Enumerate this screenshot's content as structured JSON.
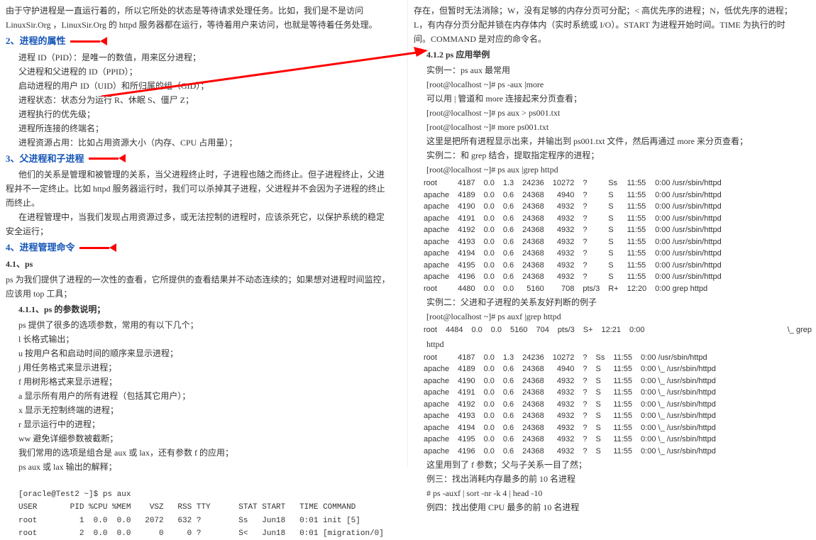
{
  "left": {
    "intro1": "由于守护进程是一直运行着的，所以它所处的状态是等待请求处理任务。比如，我们是不是访问",
    "intro2": "LinuxSir.Org ，LinuxSir.Org 的 httpd 服务器都在运行，等待着用户来访问，也就是等待着任务处理。",
    "h2": "2、进程的属性",
    "attr1": "进程 ID（PID）：是唯一的数值，用来区分进程；",
    "attr2": "父进程和父进程的 ID（PPID）；",
    "attr3": "启动进程的用户 ID（UID）和所归属的组（GID）；",
    "attr4": "进程状态：状态分为运行 R、休眠 S、僵尸 Z；",
    "attr5": "进程执行的优先级；",
    "attr6": "进程所连接的终端名；",
    "attr7": "进程资源占用：比如占用资源大小（内存、CPU 占用量）；",
    "h3": "3、父进程和子进程",
    "rel1": "他们的关系是管理和被管理的关系，当父进程终止时，子进程也随之而终止。但子进程终止，父进",
    "rel2": "程并不一定终止。比如 httpd 服务器运行时，我们可以杀掉其子进程，父进程并不会因为子进程的终止",
    "rel3": "而终止。",
    "rel4": "在进程管理中，当我们发现占用资源过多，或无法控制的进程时，应该杀死它，以保护系统的稳定",
    "rel5": "安全运行；",
    "h4": "4、进程管理命令",
    "h41": "4.1、ps",
    "ps1": "ps 为我们提供了进程的一次性的查看，它所提供的查看结果并不动态连续的；如果想对进程时间监控，",
    "ps2": "应该用 top 工具；",
    "h411": "4.1.1、ps 的参数说明；",
    "param0": "ps 提供了很多的选项参数，常用的有以下几个；",
    "param_l": "l  长格式输出；",
    "param_u": "u  按用户名和启动时间的顺序来显示进程；",
    "param_j": "j  用任务格式来显示进程；",
    "param_f": "f  用树形格式来显示进程；",
    "param_a": "a  显示所有用户的所有进程（包括其它用户）；",
    "param_x": "x  显示无控制终端的进程；",
    "param_r": "r  显示运行中的进程；",
    "param_ww": "ww 避免详细参数被截断；",
    "param_note1": "我们常用的选项是组合是 aux 或 lax，还有参数 f 的应用；",
    "param_note2": "ps aux 或 lax 输出的解释；",
    "code1": "[oracle@Test2 ~]$ ps aux",
    "code2": "USER       PID %CPU %MEM    VSZ   RSS TTY      STAT START   TIME COMMAND",
    "code3": "root         1  0.0  0.0   2072   632 ?        Ss   Jun18   0:01 init [5]",
    "code4": "root         2  0.0  0.0      0     0 ?        S<   Jun18   0:01 [migration/0]"
  },
  "right": {
    "top1": "存在，但暂时无法消除；W，没有足够的内存分页可分配；< 高优先序的进程；N，低优先序的进程；",
    "top2": "L，有内存分页分配并锁在内存体内（实时系统或 I/O）。START 为进程开始时间。TIME 为执行的时",
    "top3": "间。COMMAND 是对应的命令名。",
    "h412": "4.1.2 ps 应用举例",
    "ex1_title": "实例一：ps aux 最常用",
    "ex1_cmd": "[root@localhost ~]# ps -aux |more",
    "ex1_note": "可以用 | 管道和 more 连接起来分页查看；",
    "ex1_cmd2": "[root@localhost ~]# ps   aux   > ps001.txt",
    "ex1_cmd3": "[root@localhost ~]# more ps001.txt",
    "ex1_note2": "这里是把所有进程显示出来，并输出到 ps001.txt 文件，然后再通过 more 来分页查看；",
    "ex2_title": "实例二：和 grep 结合，提取指定程序的进程；",
    "ex2_cmd": "[root@localhost ~]# ps aux |grep httpd",
    "table1": [
      [
        "root",
        "4187",
        "0.0",
        "1.3",
        "24236",
        "10272",
        "?",
        "Ss",
        "11:55",
        "0:00 /usr/sbin/httpd"
      ],
      [
        "apache",
        "4189",
        "0.0",
        "0.6",
        "24368",
        "4940",
        "?",
        "S",
        "11:55",
        "0:00 /usr/sbin/httpd"
      ],
      [
        "apache",
        "4190",
        "0.0",
        "0.6",
        "24368",
        "4932",
        "?",
        "S",
        "11:55",
        "0:00 /usr/sbin/httpd"
      ],
      [
        "apache",
        "4191",
        "0.0",
        "0.6",
        "24368",
        "4932",
        "?",
        "S",
        "11:55",
        "0:00 /usr/sbin/httpd"
      ],
      [
        "apache",
        "4192",
        "0.0",
        "0.6",
        "24368",
        "4932",
        "?",
        "S",
        "11:55",
        "0:00 /usr/sbin/httpd"
      ],
      [
        "apache",
        "4193",
        "0.0",
        "0.6",
        "24368",
        "4932",
        "?",
        "S",
        "11:55",
        "0:00 /usr/sbin/httpd"
      ],
      [
        "apache",
        "4194",
        "0.0",
        "0.6",
        "24368",
        "4932",
        "?",
        "S",
        "11:55",
        "0:00 /usr/sbin/httpd"
      ],
      [
        "apache",
        "4195",
        "0.0",
        "0.6",
        "24368",
        "4932",
        "?",
        "S",
        "11:55",
        "0:00 /usr/sbin/httpd"
      ],
      [
        "apache",
        "4196",
        "0.0",
        "0.6",
        "24368",
        "4932",
        "?",
        "S",
        "11:55",
        "0:00 /usr/sbin/httpd"
      ],
      [
        "root",
        "4480",
        "0.0",
        "0.0",
        "5160",
        "708",
        "pts/3",
        "R+",
        "12:20",
        "0:00 grep httpd"
      ]
    ],
    "ex3_title": "实例二：父进和子进程的关系友好判断的例子",
    "ex3_cmd": "[root@localhost ~]# ps auxf   |grep httpd",
    "row_4484": [
      "root",
      "4484",
      "0.0",
      "0.0",
      "5160",
      "704",
      "pts/3",
      "S+",
      "12:21",
      "0:00"
    ],
    "row_4484_tail": "\\_ grep",
    "row_httpd": "httpd",
    "table2": [
      [
        "root",
        "4187",
        "0.0",
        "1.3",
        "24236",
        "10272",
        "?",
        "Ss",
        "11:55",
        "0:00 /usr/sbin/httpd"
      ],
      [
        "apache",
        "4189",
        "0.0",
        "0.6",
        "24368",
        "4940",
        "?",
        "S",
        "11:55",
        "0:00   \\_ /usr/sbin/httpd"
      ],
      [
        "apache",
        "4190",
        "0.0",
        "0.6",
        "24368",
        "4932",
        "?",
        "S",
        "11:55",
        "0:00   \\_ /usr/sbin/httpd"
      ],
      [
        "apache",
        "4191",
        "0.0",
        "0.6",
        "24368",
        "4932",
        "?",
        "S",
        "11:55",
        "0:00   \\_ /usr/sbin/httpd"
      ],
      [
        "apache",
        "4192",
        "0.0",
        "0.6",
        "24368",
        "4932",
        "?",
        "S",
        "11:55",
        "0:00   \\_ /usr/sbin/httpd"
      ],
      [
        "apache",
        "4193",
        "0.0",
        "0.6",
        "24368",
        "4932",
        "?",
        "S",
        "11:55",
        "0:00   \\_ /usr/sbin/httpd"
      ],
      [
        "apache",
        "4194",
        "0.0",
        "0.6",
        "24368",
        "4932",
        "?",
        "S",
        "11:55",
        "0:00   \\_ /usr/sbin/httpd"
      ],
      [
        "apache",
        "4195",
        "0.0",
        "0.6",
        "24368",
        "4932",
        "?",
        "S",
        "11:55",
        "0:00   \\_ /usr/sbin/httpd"
      ],
      [
        "apache",
        "4196",
        "0.0",
        "0.6",
        "24368",
        "4932",
        "?",
        "S",
        "11:55",
        "0:00   \\_ /usr/sbin/httpd"
      ]
    ],
    "note_f": "这里用到了 f 参数；父与子关系一目了然；",
    "ex3": "例三：找出消耗内存最多的前 10 名进程",
    "ex3cmd": "# ps -auxf | sort -nr -k 4 | head -10",
    "ex4": "例四：找出使用 CPU 最多的前 10 名进程"
  }
}
